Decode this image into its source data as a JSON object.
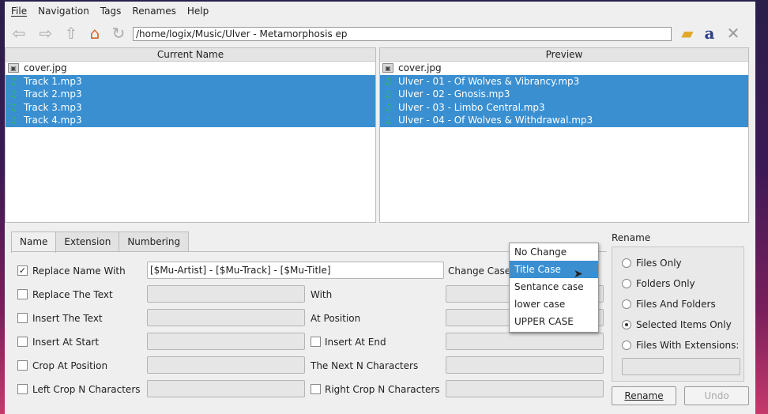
{
  "menu": [
    "File",
    "Navigation",
    "Tags",
    "Renames",
    "Help"
  ],
  "path": "/home/logix/Music/Ulver - Metamorphosis ep",
  "icons": {
    "back": "back-arrow-icon",
    "forward": "forward-arrow-icon",
    "up": "up-arrow-icon",
    "home": "home-icon",
    "refresh": "refresh-icon",
    "folder": "open-folder-icon",
    "font": "font-icon",
    "tools": "tools-icon"
  },
  "current": {
    "header": "Current Name",
    "files": [
      {
        "name": "cover.jpg",
        "sel": false,
        "type": "image"
      },
      {
        "name": "Track 1.mp3",
        "sel": true,
        "type": "music"
      },
      {
        "name": "Track 2.mp3",
        "sel": true,
        "type": "music"
      },
      {
        "name": "Track 3.mp3",
        "sel": true,
        "type": "music"
      },
      {
        "name": "Track 4.mp3",
        "sel": true,
        "type": "music"
      }
    ]
  },
  "preview": {
    "header": "Preview",
    "files": [
      {
        "name": "cover.jpg",
        "sel": false,
        "type": "image"
      },
      {
        "name": "Ulver - 01 - Of Wolves & Vibrancy.mp3",
        "sel": true,
        "type": "music"
      },
      {
        "name": "Ulver - 02 - Gnosis.mp3",
        "sel": true,
        "type": "music"
      },
      {
        "name": "Ulver - 03 - Limbo Central.mp3",
        "sel": true,
        "type": "music"
      },
      {
        "name": "Ulver - 04 - Of Wolves & Withdrawal.mp3",
        "sel": true,
        "type": "music"
      }
    ]
  },
  "tabs": [
    "Name",
    "Extension",
    "Numbering"
  ],
  "options": {
    "replace_name": "Replace Name With",
    "replace_name_value": "[$Mu-Artist] - [$Mu-Track] - [$Mu-Title]",
    "replace_text": "Replace The Text",
    "insert_text": "Insert The Text",
    "insert_start": "Insert At Start",
    "crop_position": "Crop At Position",
    "left_crop": "Left Crop N Characters",
    "with": "With",
    "at_position": "At Position",
    "insert_end": "Insert At End",
    "next_n": "The Next N Characters",
    "right_crop": "Right Crop N Characters",
    "change_case": "Change Case",
    "check": "✓"
  },
  "case_options": [
    "No Change",
    "Title Case",
    "Sentance case",
    "lower case",
    "UPPER CASE"
  ],
  "rename": {
    "group": "Rename",
    "choices": [
      "Files Only",
      "Folders Only",
      "Files And Folders",
      "Selected Items Only",
      "Files With Extensions:"
    ],
    "selected": 3,
    "rename_btn": "Rename",
    "undo_btn": "Undo"
  }
}
